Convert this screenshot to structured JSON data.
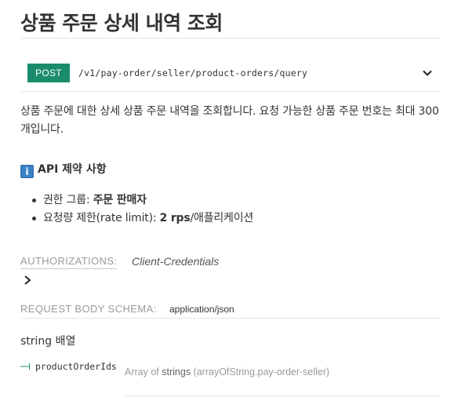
{
  "page": {
    "title": "상품 주문 상세 내역 조회"
  },
  "endpoint": {
    "method": "POST",
    "path": "/v1/pay-order/seller/product-orders/query",
    "method_color": "#1b8c6b"
  },
  "description": "상품 주문에 대한 상세 상품 주문 내역을 조회합니다. 요청 가능한 상품 주문 번호는 최대 300개입니다.",
  "constraints": {
    "icon": "info-icon",
    "icon_glyph": "i",
    "title": "API 제약 사항",
    "items": [
      {
        "prefix": "권한 그룹: ",
        "bold": "주문 판매자",
        "suffix": ""
      },
      {
        "prefix": "요청량 제한(rate limit): ",
        "bold": "2 rps",
        "suffix": "/애플리케이션"
      }
    ]
  },
  "authorizations": {
    "label": "AUTHORIZATIONS:",
    "value": "Client-Credentials"
  },
  "request_body": {
    "label": "REQUEST BODY SCHEMA:",
    "content_type": "application/json",
    "schema_type": "string 배열",
    "property": {
      "name": "productOrderIds",
      "desc_prefix": "Array of ",
      "desc_type": "strings",
      "desc_suffix": " (arrayOfString.pay-order-seller)"
    }
  }
}
